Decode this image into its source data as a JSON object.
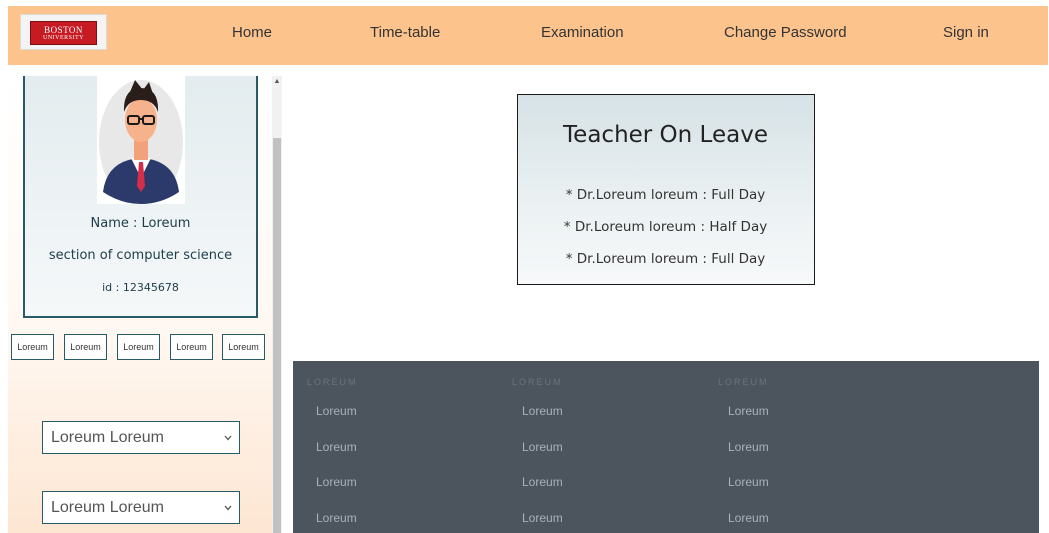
{
  "nav": {
    "logo_line1": "BOSTON",
    "logo_line2": "UNIVERSITY",
    "items": [
      "Home",
      "Time-table",
      "Examination",
      "Change Password",
      "Sign in"
    ]
  },
  "profile": {
    "name": "Name : Loreum",
    "section": "section of computer science",
    "id": "id : 12345678"
  },
  "chips": [
    "Loreum",
    "Loreum",
    "Loreum",
    "Loreum",
    "Loreum"
  ],
  "selects": [
    "Loreum Loreum",
    "Loreum Loreum"
  ],
  "leave": {
    "title": "Teacher On Leave",
    "items": [
      "* Dr.Loreum loreum : Full Day",
      "* Dr.Loreum loreum : Half Day",
      "* Dr.Loreum loreum : Full Day"
    ]
  },
  "table": {
    "headers": [
      "LOREUM",
      "LOREUM",
      "LOREUM"
    ],
    "rows": [
      [
        "Loreum",
        "Loreum",
        "Loreum"
      ],
      [
        "Loreum",
        "Loreum",
        "Loreum"
      ],
      [
        "Loreum",
        "Loreum",
        "Loreum"
      ],
      [
        "Loreum",
        "Loreum",
        "Loreum"
      ]
    ]
  },
  "colors": {
    "navbar": "#fdc38d",
    "accent": "#275966",
    "table_bg": "#4c555e",
    "logo_red": "#c71b24"
  }
}
